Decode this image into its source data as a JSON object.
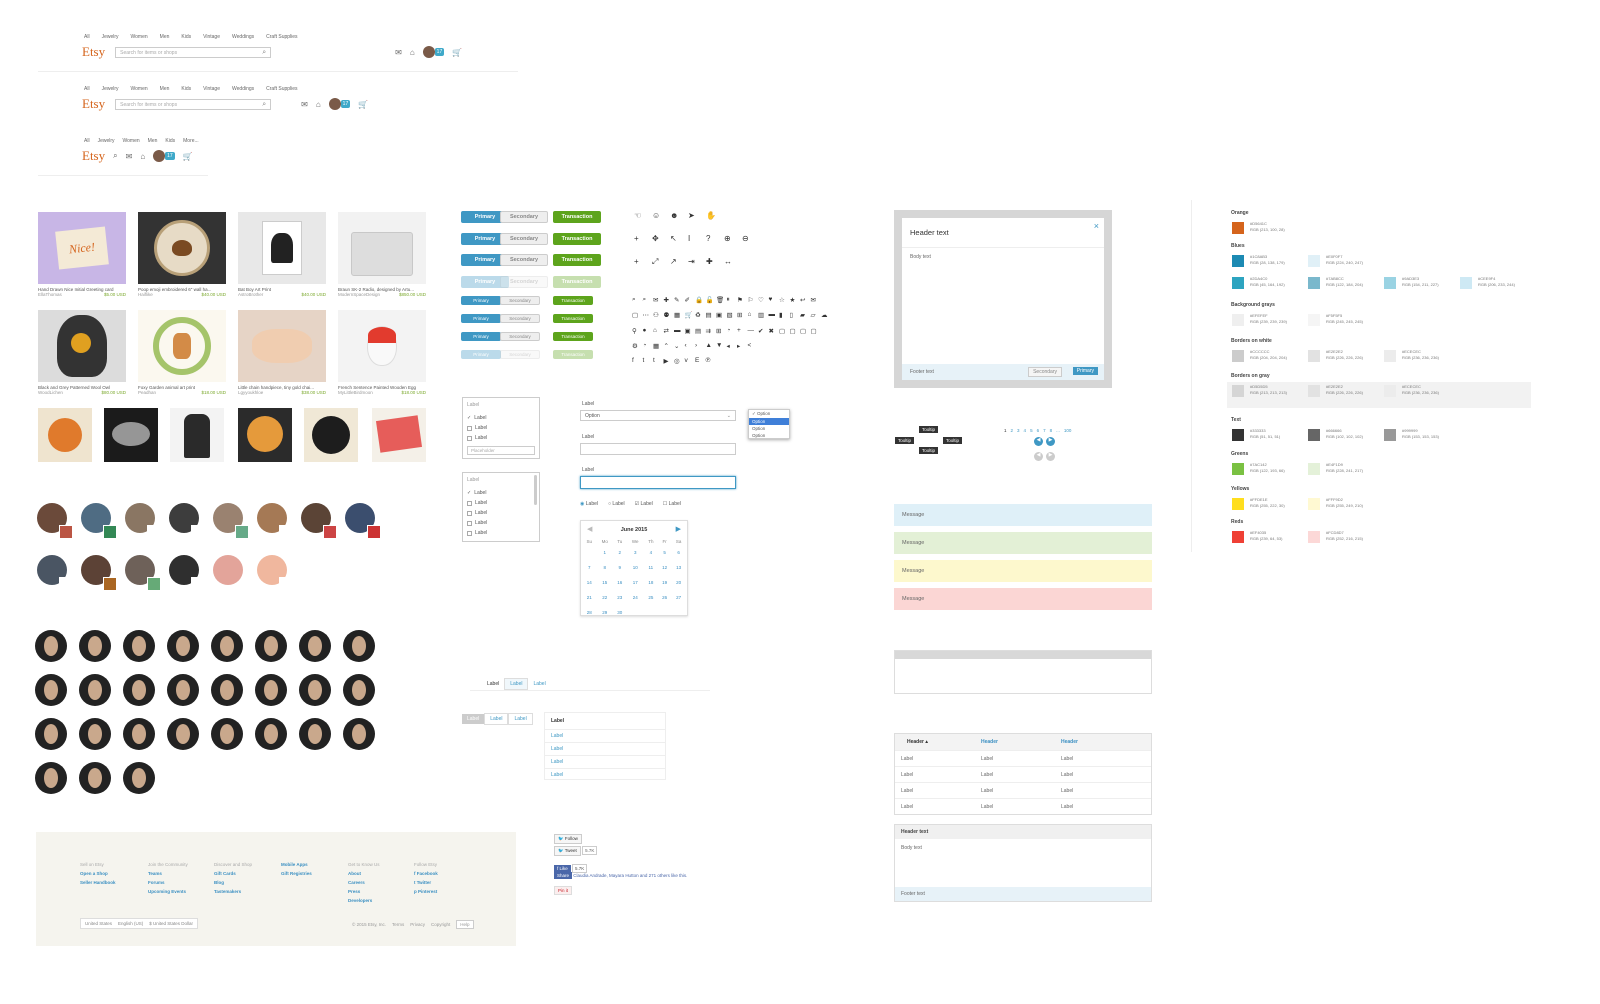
{
  "colors": {
    "orange": "#d5641c",
    "blue": "#3f98c4",
    "green": "#5da41c"
  },
  "header": {
    "nav": [
      "All",
      "Jewelry",
      "Women",
      "Men",
      "Kids",
      "Vintage",
      "Weddings",
      "Craft Supplies"
    ],
    "nav_short": [
      "All",
      "Jewelry",
      "Women",
      "Men",
      "Kids",
      "More..."
    ],
    "logo": "Etsy",
    "search_placeholder": "Search for items or shops"
  },
  "listings": [
    {
      "title": "Hand Drawn Nice Initial Greeting card",
      "shop": "EllaThomas",
      "price": "$5.00 USD",
      "art": "Nice!"
    },
    {
      "title": "Poop emoji embroidered 6\" wall ha...",
      "shop": "Haiflike",
      "price": "$40.00 USD"
    },
    {
      "title": "Bat Boy Art Print",
      "shop": "AstroBrother",
      "price": "$40.00 USD"
    },
    {
      "title": "Braun SK-2 Radio, designed by Artu...",
      "shop": "ModernSpaceDesign",
      "price": "$850.00 USD"
    },
    {
      "title": "Black and Grey Patterned Wool Owl",
      "shop": "WoodLichen",
      "price": "$80.00 USD"
    },
    {
      "title": "Foxy Garden animal art print",
      "shop": "Peadhan",
      "price": "$18.00 USD"
    },
    {
      "title": "Little chain handpiece, tiny gold chai...",
      "shop": "Lgyyoukhloe",
      "price": "$38.00 USD"
    },
    {
      "title": "French Sentence Painted Wooden Egg",
      "shop": "MyLittleBirdmoon",
      "price": "$18.00 USD"
    }
  ],
  "buttons": {
    "primary": "Primary",
    "secondary": "Secondary",
    "transaction": "Transaction"
  },
  "form": {
    "label": "Label",
    "option": "Option",
    "placeholder": "Placeholder",
    "options": [
      "Option",
      "Option",
      "Option",
      "Option"
    ],
    "calendar_month": "June 2015",
    "days": [
      "Su",
      "Mo",
      "Tu",
      "We",
      "Th",
      "Fr",
      "Sa"
    ],
    "weeks": [
      [
        "",
        "1",
        "2",
        "3",
        "4",
        "5",
        "6"
      ],
      [
        "7",
        "8",
        "9",
        "10",
        "11",
        "12",
        "13"
      ],
      [
        "14",
        "15",
        "16",
        "17",
        "18",
        "19",
        "20"
      ],
      [
        "21",
        "22",
        "23",
        "24",
        "25",
        "26",
        "27"
      ],
      [
        "28",
        "29",
        "30",
        "",
        "",
        "",
        ""
      ]
    ]
  },
  "tabs": [
    "Label",
    "Label",
    "Label"
  ],
  "list_links": [
    "Label",
    "Label",
    "Label",
    "Label",
    "Label"
  ],
  "social": {
    "follow": "Follow",
    "tweet": "Tweet",
    "tweet_count": "5.7K",
    "like": "Like",
    "like_count": "5.7K",
    "share": "Share",
    "fb_text": "Claudia Andrade, Mayara Hutton and 271 others like this.",
    "pin": "Pin it"
  },
  "overlay": {
    "header": "Header text",
    "body": "Body text",
    "footer": "Footer text",
    "secondary": "Secondary",
    "primary": "Primary",
    "close": "×"
  },
  "tooltip": "Tooltip",
  "pagination": [
    "1",
    "2",
    "3",
    "4",
    "5",
    "6",
    "7",
    "8",
    "...",
    "100"
  ],
  "messages": [
    {
      "text": "Message",
      "color": "#dff0f8"
    },
    {
      "text": "Message",
      "color": "#e3f0d6"
    },
    {
      "text": "Message",
      "color": "#fdf8cd"
    },
    {
      "text": "Message",
      "color": "#fbd6d4"
    }
  ],
  "table": {
    "headers": [
      "Header",
      "Header",
      "Header"
    ],
    "rows": [
      [
        "Label",
        "Label",
        "Label"
      ],
      [
        "Label",
        "Label",
        "Label"
      ],
      [
        "Label",
        "Label",
        "Label"
      ],
      [
        "Label",
        "Label",
        "Label"
      ]
    ]
  },
  "panel": {
    "header": "Header text",
    "body": "Body text",
    "footer": "Footer text"
  },
  "palette": [
    {
      "name": "Orange",
      "swatches": [
        {
          "hex": "#D5641C",
          "rgb": "RGB (213, 100, 28)"
        }
      ]
    },
    {
      "name": "Blues",
      "swatches": [
        {
          "hex": "#1C8AB3",
          "rgb": "RGB (28, 138, 179)"
        },
        {
          "hex": "#E0F0F7",
          "rgb": "RGB (224, 240, 247)"
        },
        {
          "hex": "#2DA4C0",
          "rgb": "RGB (45, 164, 192)"
        },
        {
          "hex": "#7AB8CC",
          "rgb": "RGB (122, 184, 204)"
        },
        {
          "hex": "#9AD3E3",
          "rgb": "RGB (154, 211, 227)"
        },
        {
          "hex": "#CEE9F4",
          "rgb": "RGB (206, 233, 244)"
        }
      ]
    },
    {
      "name": "Background grays",
      "swatches": [
        {
          "hex": "#EFEFEF",
          "rgb": "RGB (239, 239, 239)"
        },
        {
          "hex": "#F5F5F5",
          "rgb": "RGB (245, 245, 245)"
        }
      ]
    },
    {
      "name": "Borders on white",
      "swatches": [
        {
          "hex": "#CCCCCC",
          "rgb": "RGB (204, 204, 204)"
        },
        {
          "hex": "#E2E2E2",
          "rgb": "RGB (226, 226, 226)"
        },
        {
          "hex": "#ECECEC",
          "rgb": "RGB (236, 236, 236)"
        }
      ]
    },
    {
      "name": "Borders on gray",
      "swatches": [
        {
          "hex": "#D5D5D5",
          "rgb": "RGB (213, 213, 213)"
        },
        {
          "hex": "#E2E2E2",
          "rgb": "RGB (226, 226, 226)"
        },
        {
          "hex": "#ECECEC",
          "rgb": "RGB (236, 236, 236)"
        }
      ]
    },
    {
      "name": "Text",
      "swatches": [
        {
          "hex": "#333333",
          "rgb": "RGB (51, 51, 51)"
        },
        {
          "hex": "#666666",
          "rgb": "RGB (102, 102, 102)"
        },
        {
          "hex": "#999999",
          "rgb": "RGB (153, 153, 153)"
        }
      ]
    },
    {
      "name": "Greens",
      "swatches": [
        {
          "hex": "#7AC142",
          "rgb": "RGB (122, 193, 66)"
        },
        {
          "hex": "#E4F1D9",
          "rgb": "RGB (228, 241, 217)"
        }
      ]
    },
    {
      "name": "Yellows",
      "swatches": [
        {
          "hex": "#FFDE1E",
          "rgb": "RGB (255, 222, 30)"
        },
        {
          "hex": "#FFF9D2",
          "rgb": "RGB (255, 249, 210)"
        }
      ]
    },
    {
      "name": "Reds",
      "swatches": [
        {
          "hex": "#EF4035",
          "rgb": "RGB (239, 64, 53)"
        },
        {
          "hex": "#FCD8D7",
          "rgb": "RGB (252, 216, 215)"
        }
      ]
    }
  ],
  "footer": {
    "cols": [
      {
        "h": "Sell on Etsy",
        "links": [
          "Open a Shop",
          "Seller Handbook"
        ]
      },
      {
        "h": "Join the Community",
        "links": [
          "Teams",
          "Forums",
          "Upcoming Events"
        ]
      },
      {
        "h": "Discover and Shop",
        "links": [
          "Gift Cards",
          "Blog",
          "Tastemakers"
        ]
      },
      {
        "h": "",
        "links": [
          "Mobile Apps",
          "Gift Registries"
        ]
      },
      {
        "h": "Get to Know Us",
        "links": [
          "About",
          "Careers",
          "Press",
          "Developers"
        ]
      },
      {
        "h": "Follow Etsy",
        "links": [
          "Facebook",
          "Twitter",
          "Pinterest"
        ]
      }
    ],
    "locale": [
      "United States",
      "English (US)",
      "$ United States Dollar"
    ],
    "legal": [
      "© 2015 Etsy, Inc.",
      "Terms",
      "Privacy",
      "Copyright",
      "Help"
    ]
  }
}
